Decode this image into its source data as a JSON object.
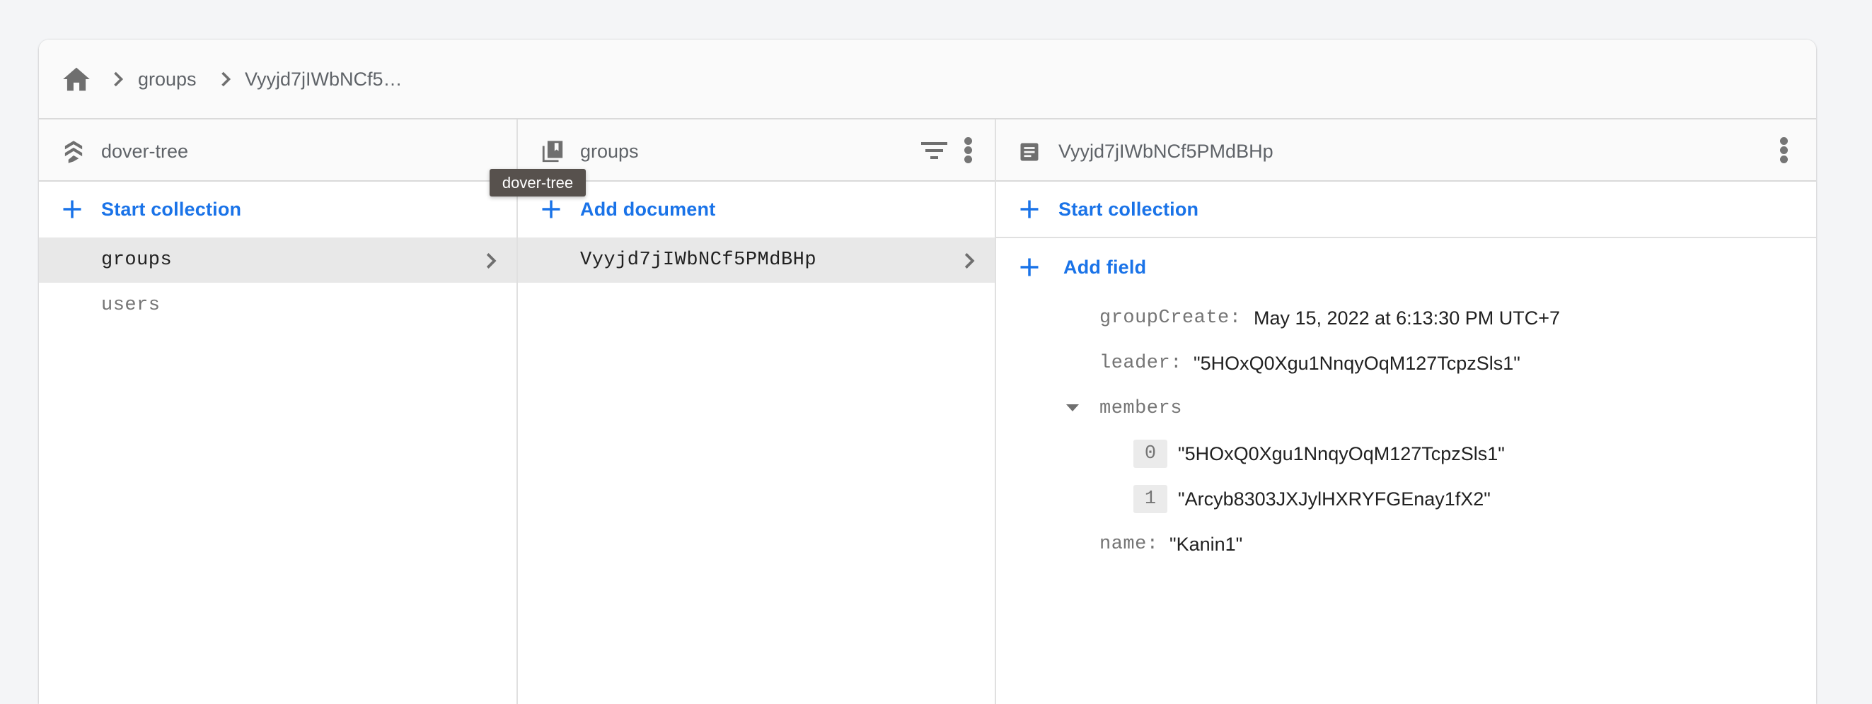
{
  "breadcrumb": {
    "home_icon": "home-icon",
    "items": [
      "groups",
      "Vyyjd7jIWbNCf5…"
    ]
  },
  "columns": {
    "root": {
      "title": "dover-tree",
      "icon": "firestore-database-icon",
      "action_label": "Start collection",
      "items": [
        {
          "label": "groups",
          "selected": true
        },
        {
          "label": "users",
          "selected": false
        }
      ]
    },
    "collection": {
      "title": "groups",
      "icon": "collection-icon",
      "action_label": "Add document",
      "items": [
        {
          "label": "Vyyjd7jIWbNCf5PMdBHp",
          "selected": true
        }
      ]
    },
    "document": {
      "title": "Vyyjd7jIWbNCf5PMdBHp",
      "icon": "document-icon",
      "action_label": "Start collection",
      "add_field_label": "Add field",
      "fields": {
        "groupCreate": {
          "key": "groupCreate:",
          "value": "May 15, 2022 at 6:13:30 PM UTC+7"
        },
        "leader": {
          "key": "leader:",
          "value": "\"5HOxQ0Xgu1NnqyOqM127TcpzSls1\""
        },
        "members": {
          "key": "members",
          "items": [
            {
              "index": "0",
              "value": "\"5HOxQ0Xgu1NnqyOqM127TcpzSls1\""
            },
            {
              "index": "1",
              "value": "\"Arcyb8303JXJylHXRYFGEnay1fX2\""
            }
          ]
        },
        "name": {
          "key": "name:",
          "value": "\"Kanin1\""
        }
      }
    }
  },
  "tooltip": "dover-tree",
  "colors": {
    "accent": "#1a73e8",
    "tooltip_bg": "#57514d",
    "selected_row": "#e8e8e8"
  }
}
